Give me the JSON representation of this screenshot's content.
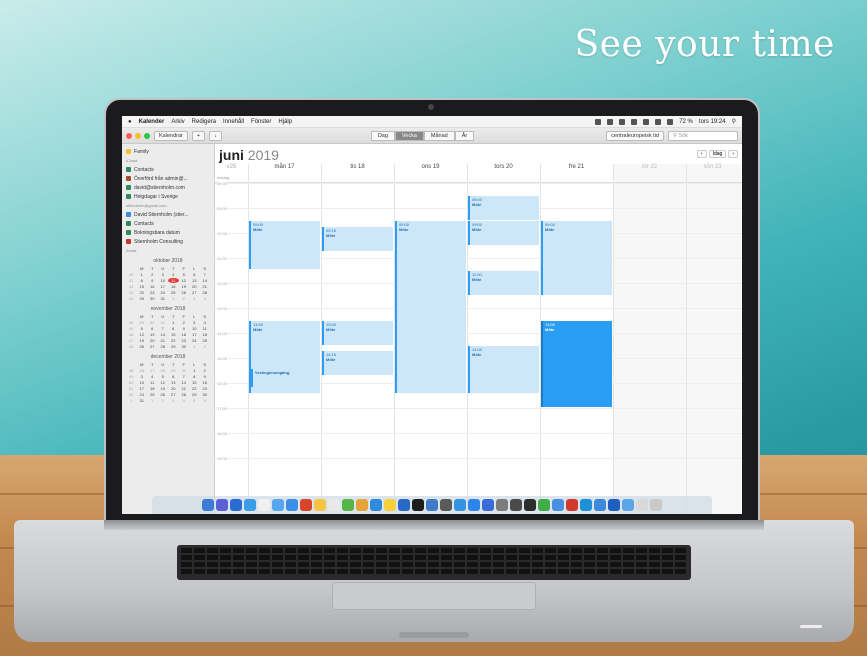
{
  "headline": "See your time",
  "menubar": {
    "apple": "",
    "app": "Kalender",
    "items": [
      "Arkiv",
      "Redigera",
      "Innehåll",
      "Fönster",
      "Hjälp"
    ],
    "status_text": "72 %",
    "clock": "tors 19:24"
  },
  "toolbar": {
    "calendars_btn": "Kalendrar",
    "add_btn": "+",
    "inbox_btn": "↓",
    "views": [
      "Dag",
      "Vecka",
      "Månad",
      "År"
    ],
    "active_view": "Vecka",
    "timezone": "centraleuropeisk tid",
    "search_placeholder": "Sök"
  },
  "sidebar": {
    "family": "Family",
    "account1": "iCloud",
    "group1": [
      {
        "label": "Contacts",
        "color": "#2e8b57"
      },
      {
        "label": "Överförd från admin@...",
        "color": "#a0522d"
      },
      {
        "label": "david@stiernholm.com",
        "color": "#2e8b57"
      },
      {
        "label": "Helgdagar i Sverige",
        "color": "#2e8b57"
      }
    ],
    "account2": "stiernholm@gmail.com",
    "group2": [
      {
        "label": "David Stiernholm (stier...",
        "color": "#3b8be0"
      },
      {
        "label": "Contacts",
        "color": "#2e8b57"
      },
      {
        "label": "Bokningsbara datum",
        "color": "#2e8b57"
      },
      {
        "label": "Stiernholm Consulting",
        "color": "#c0392b"
      }
    ],
    "other": "Annat"
  },
  "mini_calendars": [
    {
      "title": "oktober 2018"
    },
    {
      "title": "november 2018"
    },
    {
      "title": "december 2018"
    }
  ],
  "calendar": {
    "month": "juni",
    "year": "2019",
    "today_btn": "Idag",
    "week": "v25",
    "days": [
      "mån 17",
      "tis 18",
      "ons 19",
      "tors 20",
      "fre 21",
      "lör 22",
      "sön 23"
    ],
    "allday_label": "heldag",
    "hours": [
      "08:00",
      "09:00",
      "10:00",
      "11:00",
      "12:00",
      "13:00",
      "14:00",
      "15:00",
      "16:00",
      "17:00",
      "18:00",
      "19:00"
    ]
  },
  "events": [
    {
      "time": "09:00",
      "title": "Möte"
    },
    {
      "time": "09:15",
      "title": "Möte"
    },
    {
      "time": "09:00",
      "title": "Möte"
    },
    {
      "time": "08:00",
      "title": "Möte"
    },
    {
      "time": "09:00",
      "title": "Möte"
    },
    {
      "time": "09:00",
      "title": "Möte"
    },
    {
      "time": "11:00",
      "title": "Möte"
    },
    {
      "time": "13:00",
      "title": "Möte"
    },
    {
      "time": "13:00",
      "title": "Möte"
    },
    {
      "time": "14:15",
      "title": "Möte"
    },
    {
      "time": "",
      "title": "Veckogenomgång,"
    },
    {
      "time": "14:00",
      "title": "Möte"
    },
    {
      "time": "13:00",
      "title": "Möte"
    }
  ],
  "colors": {
    "event_light": "#cde7f8",
    "event_dark": "#2a9df4",
    "today_red": "#e63b2e"
  }
}
